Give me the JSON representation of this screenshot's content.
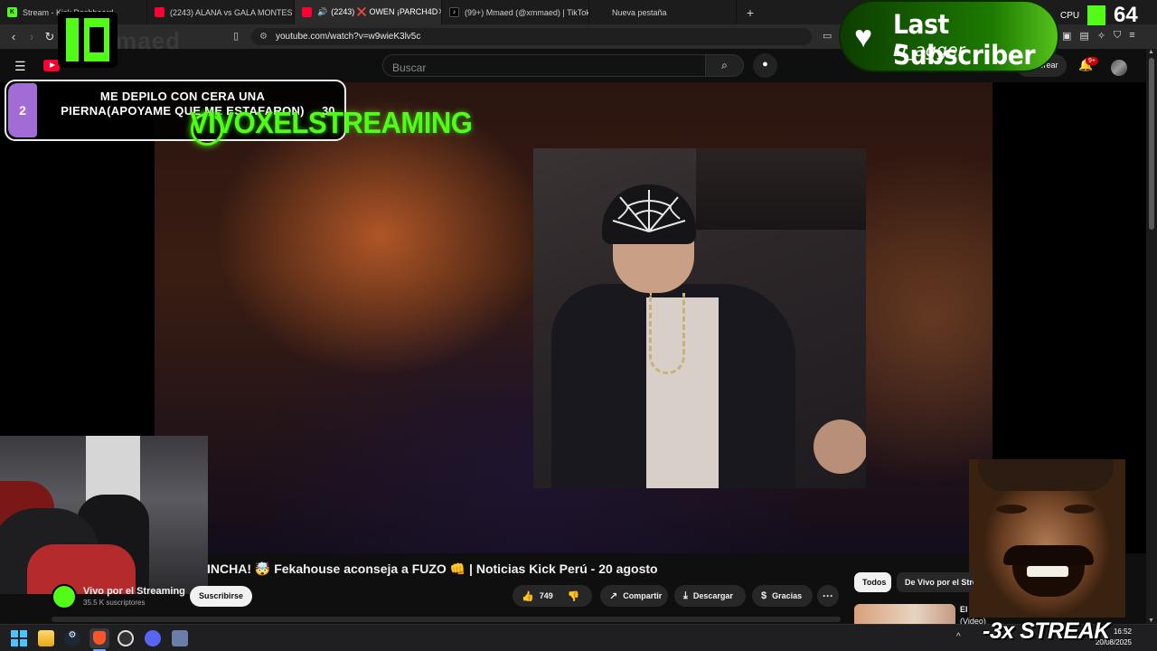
{
  "browser": {
    "tabs": [
      {
        "label": "Stream - Kick Dashboard",
        "favicon": "kick-icon"
      },
      {
        "label": "(2243) ALANA vs GALA MONTES | SU",
        "favicon": "youtube-icon"
      },
      {
        "label": "(2243) ❌ OWEN ¡PARCH4D",
        "favicon": "youtube-icon",
        "active": true
      },
      {
        "label": "(99+) Mmaed (@xmmaed) | TikTok",
        "favicon": "tiktok-icon"
      },
      {
        "label": "Nueva pestaña",
        "favicon": ""
      }
    ],
    "new_tab": "+",
    "url": "youtube.com/watch?v=w9wieK3lv5c"
  },
  "youtube": {
    "search_placeholder": "Buscar",
    "create_label": "Crear",
    "notifications_badge": "9+"
  },
  "overlays": {
    "goal": {
      "number": "2",
      "text": "ME DEPILO CON CERA UNA PIERNA(APOYAME QUE ME ESTAFARON)",
      "count": "30"
    },
    "channel_ghost": "maed",
    "channel_overlay": "VIVOXELSTREAMING",
    "last_subscriber": {
      "title": "Last Subscriber",
      "name": "D_agger"
    },
    "cpu": {
      "label": "CPU",
      "value": "64"
    },
    "streak": "-3x STREAK"
  },
  "video": {
    "title": "INCHA! 🤯 Fekahouse aconseja a FUZO 👊 | Noticias Kick Perú - 20 agosto",
    "channel_name": "Vivo por el Streaming",
    "subscribers": "35.5 K suscriptores",
    "subscribe_label": "Suscribirse",
    "likes": "749",
    "share_label": "Compartir",
    "download_label": "Descargar",
    "thanks_label": "Gracias",
    "more_label": "···"
  },
  "sidebar": {
    "chips": [
      "Todos",
      "De Vivo por el Streaming"
    ],
    "rec_title": "El",
    "rec_sub": "(Video)"
  },
  "taskbar": {
    "time": "16:52",
    "date": "20/08/2025",
    "tray": "^"
  },
  "colors": {
    "kick_green": "#53fc18",
    "youtube_red": "#ff0033",
    "background": "#0f0f0f"
  }
}
